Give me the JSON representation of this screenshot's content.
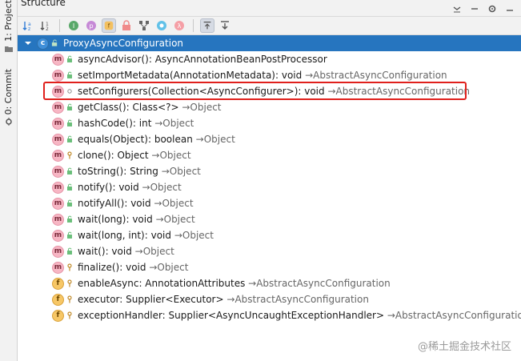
{
  "panel": {
    "title": "Structure"
  },
  "side_tabs": [
    {
      "label": "1: Project"
    },
    {
      "label": "0: Commit"
    }
  ],
  "tree": {
    "root": {
      "label": "ProxyAsyncConfiguration"
    },
    "items": [
      {
        "kind": "m",
        "visibility": "public",
        "name": "asyncAdvisor(): AsyncAnnotationBeanPostProcessor",
        "origin": ""
      },
      {
        "kind": "m",
        "visibility": "public",
        "name": "setImportMetadata(AnnotationMetadata): void",
        "origin": "→AbstractAsyncConfiguration"
      },
      {
        "kind": "m",
        "visibility": "package",
        "name": "setConfigurers(Collection<AsyncConfigurer>): void",
        "origin": "→AbstractAsyncConfiguration"
      },
      {
        "kind": "m",
        "visibility": "public",
        "name": "getClass(): Class<?>",
        "origin": "→Object"
      },
      {
        "kind": "m",
        "visibility": "public",
        "name": "hashCode(): int",
        "origin": "→Object"
      },
      {
        "kind": "m",
        "visibility": "public",
        "name": "equals(Object): boolean",
        "origin": "→Object"
      },
      {
        "kind": "m",
        "visibility": "protected",
        "name": "clone(): Object",
        "origin": "→Object"
      },
      {
        "kind": "m",
        "visibility": "public",
        "name": "toString(): String",
        "origin": "→Object"
      },
      {
        "kind": "m",
        "visibility": "public",
        "name": "notify(): void",
        "origin": "→Object"
      },
      {
        "kind": "m",
        "visibility": "public",
        "name": "notifyAll(): void",
        "origin": "→Object"
      },
      {
        "kind": "m",
        "visibility": "public",
        "name": "wait(long): void",
        "origin": "→Object"
      },
      {
        "kind": "m",
        "visibility": "public",
        "name": "wait(long, int): void",
        "origin": "→Object"
      },
      {
        "kind": "m",
        "visibility": "public",
        "name": "wait(): void",
        "origin": "→Object"
      },
      {
        "kind": "m",
        "visibility": "protected",
        "name": "finalize(): void",
        "origin": "→Object"
      },
      {
        "kind": "f",
        "visibility": "protected",
        "name": "enableAsync: AnnotationAttributes",
        "origin": "→AbstractAsyncConfiguration"
      },
      {
        "kind": "f",
        "visibility": "protected",
        "name": "executor: Supplier<Executor>",
        "origin": "→AbstractAsyncConfiguration"
      },
      {
        "kind": "f",
        "visibility": "protected",
        "name": "exceptionHandler: Supplier<AsyncUncaughtExceptionHandler>",
        "origin": "→AbstractAsyncConfiguration"
      }
    ]
  },
  "watermark": "@稀土掘金技术社区",
  "colors": {
    "selection": "#2675bf",
    "highlight": "#e0201c"
  }
}
